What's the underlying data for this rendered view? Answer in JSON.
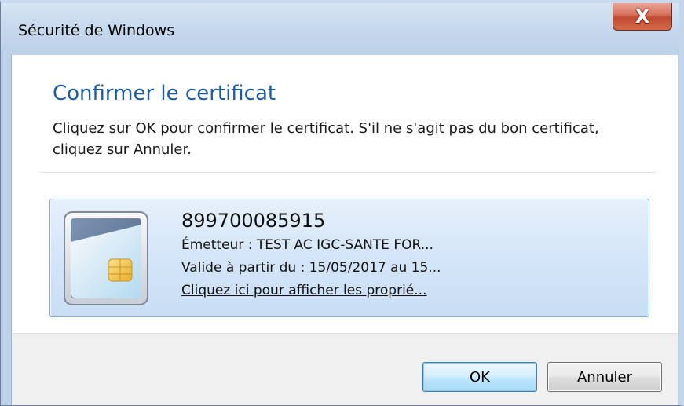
{
  "window": {
    "title": "Sécurité de Windows",
    "close_label": "X"
  },
  "dialog": {
    "heading": "Confirmer le certificat",
    "description": "Cliquez sur OK pour confirmer le certificat. S'il ne s'agit pas du bon certificat, cliquez sur Annuler."
  },
  "certificate": {
    "id": "899700085915",
    "issuer": "Émetteur : TEST AC IGC-SANTE FOR...",
    "validity": "Valide à partir du : 15/05/2017 au 15...",
    "details_link": "Cliquez ici pour afficher les proprié...",
    "icon": "smart-card-icon"
  },
  "buttons": {
    "ok_label": "OK",
    "cancel_label": "Annuler"
  },
  "colors": {
    "heading": "#1e5a9e",
    "tile_border": "#84acdd",
    "ok_border": "#3c7fb1"
  }
}
